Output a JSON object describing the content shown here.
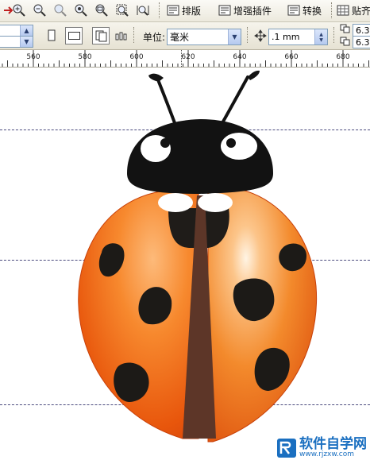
{
  "toolbar": {
    "layout_label": "排版",
    "plugin_label": "增强插件",
    "convert_label": "转换",
    "snap_label": "贴齐"
  },
  "property_bar": {
    "units_label": "单位:",
    "units_value": "毫米",
    "nudge_value": ".1 mm",
    "dup_x": "6.3",
    "dup_y": "6.3"
  },
  "ruler": {
    "ticks": [
      "560",
      "580",
      "600",
      "620",
      "640",
      "660",
      "680"
    ]
  },
  "watermark": {
    "brand": "软件自学网",
    "url": "www.rjzxw.com"
  },
  "colors": {
    "body_orange": "#f07a1a",
    "spot": "#1c1a17",
    "head": "#121212",
    "wing_seam": "#5d3628",
    "guide": "#4a4a7e"
  }
}
